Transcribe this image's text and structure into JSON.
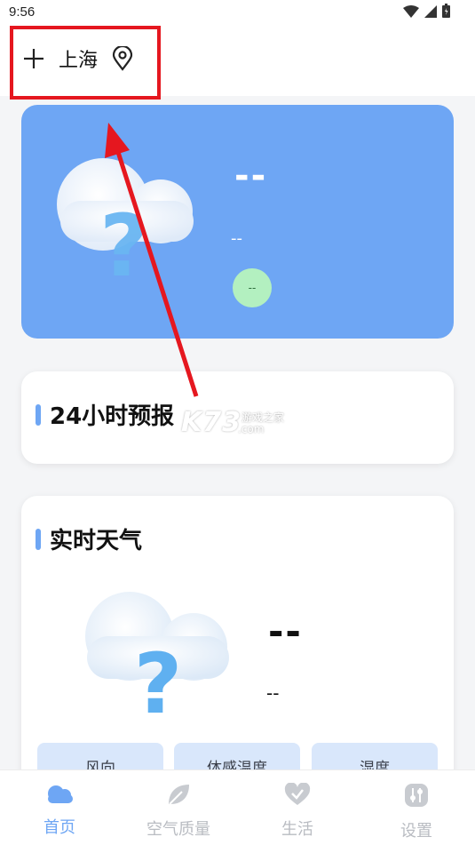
{
  "status_bar": {
    "time": "9:56"
  },
  "header": {
    "city": "上海"
  },
  "hero": {
    "temperature": "--",
    "condition": "--",
    "aqi": "--"
  },
  "forecast": {
    "title": "24小时预报"
  },
  "realtime": {
    "title": "实时天气",
    "temperature": "--",
    "condition": "--",
    "details": [
      "风向",
      "体感温度",
      "湿度"
    ]
  },
  "watermark": {
    "brand": "K73",
    "site_cn": "游戏之家",
    "domain": ".com"
  },
  "bottom_nav": [
    {
      "label": "首页",
      "icon": "cloud-icon",
      "active": true
    },
    {
      "label": "空气质量",
      "icon": "leaf-icon",
      "active": false
    },
    {
      "label": "生活",
      "icon": "heart-check-icon",
      "active": false
    },
    {
      "label": "设置",
      "icon": "sliders-icon",
      "active": false
    }
  ],
  "colors": {
    "accent": "#6ea6f4",
    "highlight": "#e5171f",
    "aqi_good": "#b3f0c0",
    "chip_bg": "#d9e7fb"
  }
}
